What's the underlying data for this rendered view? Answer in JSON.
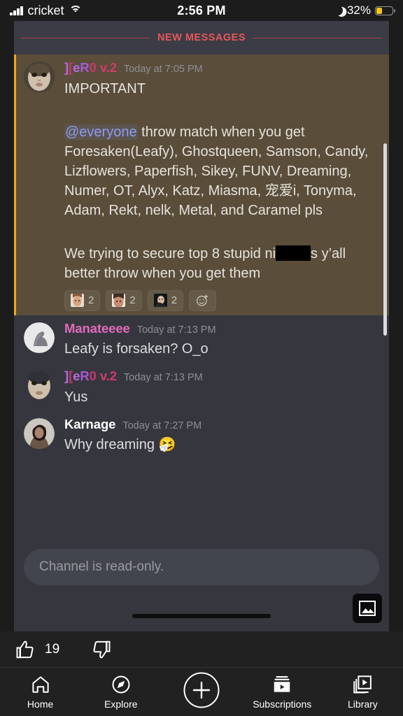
{
  "status_bar": {
    "carrier": "cricket",
    "time": "2:56 PM",
    "battery_percent": "32%",
    "signal_icon": "signal-bars-icon",
    "wifi_icon": "wifi-icon",
    "moon_icon": "do-not-disturb-moon-icon",
    "battery_icon": "battery-icon",
    "battery_fill_color": "#f5c518"
  },
  "chat": {
    "divider_label": "NEW MESSAGES",
    "divider_color": "#e8565c",
    "mention_background": "#5a4d3a",
    "mention_border_color": "#f0a81e",
    "background": "#36373e",
    "messages": [
      {
        "author": "][eRO v.2",
        "timestamp": "Today at 7:05 PM",
        "avatar_icon": "doll-face-avatar",
        "line1": "IMPORTANT",
        "mention": "@everyone",
        "line2": " throw match when you get Foresaken(Leafy), Ghostqueen, Samson, Candy, Lizflowers, Paperfish, Sikey, FUNV, Dreaming, Numer, OT, Alyx, Katz, Miasma, 宠爱i, Tonyma, Adam, Rekt, nelk, Metal, and Caramel pls",
        "line3_a": "We trying to secure top 8 stupid ni",
        "line3_b": "s y’all better throw when you get them",
        "reactions": [
          {
            "emoji_icon": "custom-emoji-face-1",
            "count": "2"
          },
          {
            "emoji_icon": "custom-emoji-face-2",
            "count": "2"
          },
          {
            "emoji_icon": "custom-emoji-face-3",
            "count": "2"
          }
        ],
        "add_reaction_icon": "add-reaction-icon"
      },
      {
        "author": "Manateeee",
        "timestamp": "Today at 7:13 PM",
        "avatar_icon": "seal-avatar",
        "text": "Leafy is forsaken? O_o",
        "name_color": "#e06bbd"
      },
      {
        "author": "][eRO v.2",
        "timestamp": "Today at 7:13 PM",
        "avatar_icon": "doll-face-avatar",
        "text": "Yus"
      },
      {
        "author": "Karnage",
        "timestamp": "Today at 7:27 PM",
        "avatar_icon": "woman-photo-avatar",
        "text": "Why dreaming 🤧",
        "name_color": "#ffffff"
      }
    ]
  },
  "composer": {
    "placeholder": "Channel is read-only.",
    "photo_button_icon": "photo-picker-icon"
  },
  "video_actions": {
    "like_icon": "thumbs-up-icon",
    "like_count": "19",
    "dislike_icon": "thumbs-down-icon"
  },
  "bottom_nav": {
    "items": [
      {
        "label": "Home",
        "icon": "home-icon"
      },
      {
        "label": "Explore",
        "icon": "compass-icon"
      },
      {
        "label": "",
        "icon": "create-plus-icon"
      },
      {
        "label": "Subscriptions",
        "icon": "subscriptions-icon"
      },
      {
        "label": "Library",
        "icon": "library-icon"
      }
    ]
  }
}
